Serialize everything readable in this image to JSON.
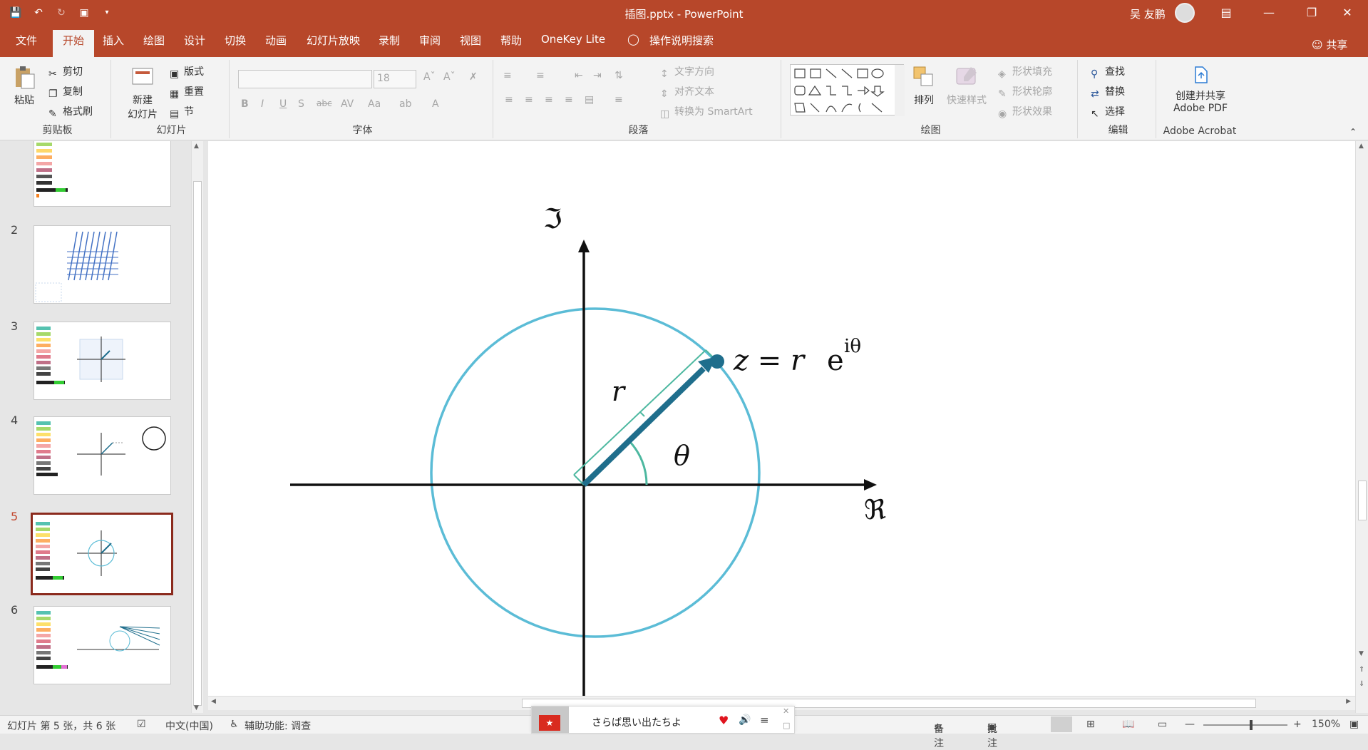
{
  "window": {
    "title": "插图.pptx  -  PowerPoint",
    "user": "吴 友鹏"
  },
  "tabs": [
    "文件",
    "开始",
    "插入",
    "绘图",
    "设计",
    "切换",
    "动画",
    "幻灯片放映",
    "录制",
    "审阅",
    "视图",
    "帮助",
    "OneKey Lite"
  ],
  "tell_me": "操作说明搜索",
  "share": "共享",
  "ribbon": {
    "clipboard": {
      "paste": "粘贴",
      "cut": "剪切",
      "copy": "复制",
      "format_painter": "格式刷",
      "label": "剪贴板"
    },
    "slides": {
      "new_slide_line1": "新建",
      "new_slide_line2": "幻灯片",
      "layout": "版式",
      "reset": "重置",
      "section": "节",
      "label": "幻灯片"
    },
    "font": {
      "size": "18",
      "label": "字体"
    },
    "paragraph": {
      "text_direction": "文字方向",
      "align_text": "对齐文本",
      "convert_smartart": "转换为 SmartArt",
      "label": "段落"
    },
    "drawing": {
      "arrange": "排列",
      "quick_styles": "快速样式",
      "shape_fill": "形状填充",
      "shape_outline": "形状轮廓",
      "shape_effects": "形状效果",
      "label": "绘图"
    },
    "editing": {
      "find": "查找",
      "replace": "替换",
      "select": "选择",
      "label": "编辑"
    },
    "acrobat": {
      "line1": "创建并共享",
      "line2": "Adobe PDF",
      "label": "Adobe Acrobat"
    }
  },
  "slide_numbers": [
    "2",
    "3",
    "4",
    "5",
    "6"
  ],
  "slide": {
    "imag_label": "ℑ",
    "real_label": "ℜ",
    "r_label": "r",
    "theta_label": "θ",
    "formula_z": "z = r",
    "formula_e": "e",
    "formula_exp": "iθ"
  },
  "status": {
    "slide_info": "幻灯片 第 5 张，共 6 张",
    "language": "中文(中国)",
    "accessibility": "辅助功能: 调查",
    "notes": "备注",
    "comments": "批注",
    "zoom": "150%"
  },
  "music": {
    "song": "さらば思い出たちよ"
  },
  "colors": {
    "accent": "#b7472a",
    "circle": "#5bbcd6",
    "vector": "#1f6e8c",
    "bracket": "#4db8a0"
  }
}
